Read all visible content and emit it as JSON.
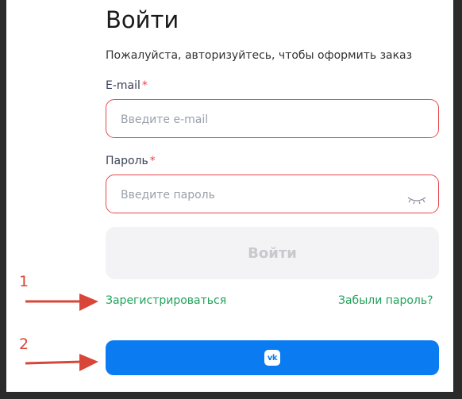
{
  "login": {
    "title": "Войти",
    "subtitle": "Пожалуйста, авторизуйтесь, чтобы оформить заказ",
    "email_label": "E-mail",
    "email_placeholder": "Введите e-mail",
    "password_label": "Пароль",
    "password_placeholder": "Введите пароль",
    "required_mark": "*",
    "submit_label": "Войти",
    "register_link": "Зарегистрироваться",
    "forgot_link": "Забыли пароль?",
    "vk_button_icon": "vk-logo-icon",
    "vk_logo_text": "vk"
  },
  "annotations": {
    "marker_1": "1",
    "marker_2": "2"
  },
  "colors": {
    "error_border": "#e5484d",
    "link_green": "#1fa35a",
    "vk_blue": "#0a7bf0",
    "annotation_red": "#d8463a"
  }
}
